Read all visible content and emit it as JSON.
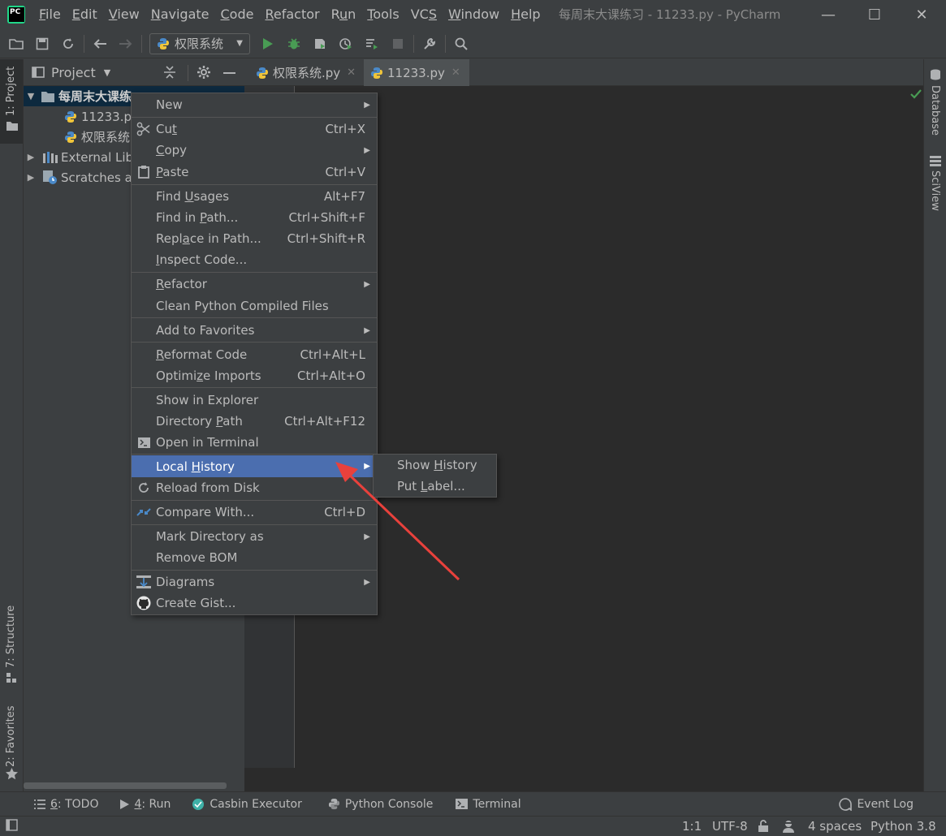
{
  "window": {
    "title": "每周末大课练习 - 11233.py - PyCharm",
    "minimize": "—",
    "maximize": "☐",
    "close": "✕"
  },
  "menu": [
    {
      "label": "File",
      "mn": "F",
      "rest": "ile"
    },
    {
      "label": "Edit",
      "mn": "E",
      "rest": "dit"
    },
    {
      "label": "View",
      "mn": "V",
      "rest": "iew"
    },
    {
      "label": "Navigate",
      "mn": "N",
      "rest": "avigate"
    },
    {
      "label": "Code",
      "mn": "C",
      "rest": "ode"
    },
    {
      "label": "Refactor",
      "mn": "R",
      "rest": "efactor"
    },
    {
      "label": "Run",
      "pre": "R",
      "mn": "u",
      "rest": "n"
    },
    {
      "label": "Tools",
      "mn": "T",
      "rest": "ools"
    },
    {
      "label": "VCS",
      "pre": "VC",
      "mn": "S",
      "rest": ""
    },
    {
      "label": "Window",
      "mn": "W",
      "rest": "indow"
    },
    {
      "label": "Help",
      "mn": "H",
      "rest": "elp"
    }
  ],
  "toolbar": {
    "run_config": "权限系统"
  },
  "left_strip": {
    "project": "1: Project",
    "structure": "7: Structure",
    "favorites": "2: Favorites"
  },
  "right_strip": {
    "database": "Database",
    "sciview": "SciView"
  },
  "project_panel": {
    "title": "Project",
    "tree": [
      {
        "label": "每周末大课练",
        "kind": "folder",
        "expanded": true,
        "selected": true
      },
      {
        "label": "11233.py",
        "kind": "py"
      },
      {
        "label": "权限系统",
        "kind": "py"
      },
      {
        "label": "External Lib",
        "kind": "lib"
      },
      {
        "label": "Scratches a",
        "kind": "scratch"
      }
    ]
  },
  "editor_tabs": [
    {
      "label": "权限系统.py",
      "active": false
    },
    {
      "label": "11233.py",
      "active": true
    }
  ],
  "context_menu": [
    {
      "label": "New",
      "submenu": true
    },
    {
      "sep": true
    },
    {
      "pre": "",
      "mn": "",
      "label": "Cut",
      "mnLabel": "Cu",
      "shortcut": "Ctrl+X",
      "icon": "scissors-icon"
    },
    {
      "label": "Copy",
      "submenu": true
    },
    {
      "label": "Paste",
      "shortcut": "Ctrl+V",
      "icon": "clipboard-icon"
    },
    {
      "sep": true
    },
    {
      "label": "Find Usages",
      "shortcut": "Alt+F7"
    },
    {
      "label": "Find in Path...",
      "shortcut": "Ctrl+Shift+F"
    },
    {
      "label": "Replace in Path...",
      "shortcut": "Ctrl+Shift+R"
    },
    {
      "label": "Inspect Code..."
    },
    {
      "sep": true
    },
    {
      "label": "Refactor",
      "submenu": true
    },
    {
      "label": "Clean Python Compiled Files"
    },
    {
      "sep": true
    },
    {
      "label": "Add to Favorites",
      "submenu": true
    },
    {
      "sep": true
    },
    {
      "label": "Reformat Code",
      "shortcut": "Ctrl+Alt+L"
    },
    {
      "label": "Optimize Imports",
      "shortcut": "Ctrl+Alt+O"
    },
    {
      "sep": true
    },
    {
      "label": "Show in Explorer"
    },
    {
      "label": "Directory Path",
      "shortcut": "Ctrl+Alt+F12"
    },
    {
      "label": "Open in Terminal",
      "icon": "terminal-icon"
    },
    {
      "sep": true
    },
    {
      "label": "Local History",
      "submenu": true,
      "highlighted": true
    },
    {
      "label": "Reload from Disk",
      "icon": "reload-icon"
    },
    {
      "sep": true
    },
    {
      "label": "Compare With...",
      "shortcut": "Ctrl+D",
      "icon": "compare-icon"
    },
    {
      "sep": true
    },
    {
      "label": "Mark Directory as",
      "submenu": true
    },
    {
      "label": "Remove BOM"
    },
    {
      "sep": true
    },
    {
      "label": "Diagrams",
      "submenu": true,
      "icon": "diagram-icon"
    },
    {
      "label": "Create Gist...",
      "icon": "github-icon"
    }
  ],
  "submenu": {
    "items": [
      "Show History",
      "Put Label..."
    ]
  },
  "bottom_tools": {
    "todo": "6: TODO",
    "run": "4: Run",
    "casbin": "Casbin Executor",
    "console": "Python Console",
    "terminal": "Terminal",
    "event_log": "Event Log"
  },
  "status": {
    "position": "1:1",
    "encoding": "UTF-8",
    "indent": "4 spaces",
    "interpreter": "Python 3.8"
  },
  "colors": {
    "highlight": "#4b6eaf",
    "arrow": "#e8413c",
    "run_green": "#499c54"
  }
}
